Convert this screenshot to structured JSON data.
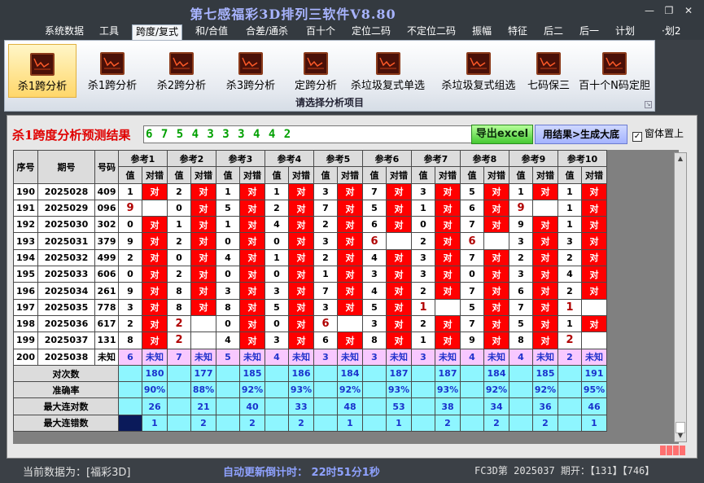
{
  "app": {
    "title": "第七感福彩3D排列三软件V8.80",
    "window_controls": {
      "minimize": "—",
      "restore": "❐",
      "close": "✕"
    }
  },
  "menu": {
    "items": [
      "系统数据",
      "工具",
      "跨度/复式",
      "和/合值",
      "合差/通杀",
      "百十个",
      "定位二码",
      "不定位二码",
      "振幅",
      "特征",
      "后二",
      "后一",
      "计划",
      "·划2"
    ],
    "active_index": 2
  },
  "ribbon": {
    "buttons": [
      "杀1跨分析",
      "杀1跨分析",
      "杀2跨分析",
      "杀3跨分析",
      "定跨分析",
      "杀垃圾复式单选",
      "杀垃圾复式组选",
      "七码保三",
      "百十个N码定胆"
    ],
    "selected_index": 0,
    "caption": "请选择分析项目",
    "icon": "chart-icon"
  },
  "panel": {
    "prediction_title": "杀1跨度分析预测结果",
    "prediction_value": "6 7 5 4 3 3 3 4 4 2",
    "export_button": "导出excel",
    "generate_button": "用结果>生成大底",
    "always_on_top_label": "窗体置上",
    "always_on_top_checked": true,
    "checkmark": "✓"
  },
  "grid": {
    "headers": {
      "seq": "序号",
      "period": "期号",
      "number": "号码",
      "value": "值",
      "correct": "对错"
    },
    "refs": [
      "参考1",
      "参考2",
      "参考3",
      "参考4",
      "参考5",
      "参考6",
      "参考7",
      "参考8",
      "参考9",
      "参考10"
    ],
    "correct_mark": "对",
    "rows": [
      {
        "seq": "190",
        "period": "2025028",
        "number": "409",
        "vals": [
          "1",
          "2",
          "1",
          "1",
          "3",
          "7",
          "3",
          "5",
          "1",
          "1"
        ],
        "ok": [
          1,
          1,
          1,
          1,
          1,
          1,
          1,
          1,
          1,
          1
        ],
        "alt": []
      },
      {
        "seq": "191",
        "period": "2025029",
        "number": "096",
        "vals": [
          "9",
          "0",
          "5",
          "2",
          "7",
          "5",
          "1",
          "6",
          "9",
          "1"
        ],
        "ok": [
          0,
          1,
          1,
          1,
          1,
          1,
          1,
          1,
          0,
          1
        ],
        "alt": [
          0,
          8
        ]
      },
      {
        "seq": "192",
        "period": "2025030",
        "number": "302",
        "vals": [
          "0",
          "1",
          "1",
          "4",
          "2",
          "6",
          "0",
          "7",
          "9",
          "1"
        ],
        "ok": [
          1,
          1,
          1,
          1,
          1,
          1,
          1,
          1,
          1,
          1
        ],
        "alt": []
      },
      {
        "seq": "193",
        "period": "2025031",
        "number": "379",
        "vals": [
          "9",
          "2",
          "0",
          "0",
          "3",
          "6",
          "2",
          "6",
          "3",
          "3"
        ],
        "ok": [
          1,
          1,
          1,
          1,
          1,
          0,
          1,
          0,
          1,
          1
        ],
        "alt": [
          5,
          7
        ]
      },
      {
        "seq": "194",
        "period": "2025032",
        "number": "499",
        "vals": [
          "2",
          "0",
          "4",
          "1",
          "2",
          "4",
          "3",
          "7",
          "2",
          "2"
        ],
        "ok": [
          1,
          1,
          1,
          1,
          1,
          1,
          1,
          1,
          1,
          1
        ],
        "alt": []
      },
      {
        "seq": "195",
        "period": "2025033",
        "number": "606",
        "vals": [
          "0",
          "2",
          "0",
          "0",
          "1",
          "3",
          "3",
          "0",
          "3",
          "4"
        ],
        "ok": [
          1,
          1,
          1,
          1,
          1,
          1,
          1,
          1,
          1,
          1
        ],
        "alt": []
      },
      {
        "seq": "196",
        "period": "2025034",
        "number": "261",
        "vals": [
          "9",
          "8",
          "3",
          "3",
          "7",
          "4",
          "2",
          "7",
          "6",
          "2"
        ],
        "ok": [
          1,
          1,
          1,
          1,
          1,
          1,
          1,
          1,
          1,
          1
        ],
        "alt": []
      },
      {
        "seq": "197",
        "period": "2025035",
        "number": "778",
        "vals": [
          "3",
          "8",
          "8",
          "5",
          "3",
          "5",
          "1",
          "5",
          "7",
          "1"
        ],
        "ok": [
          1,
          1,
          1,
          1,
          1,
          1,
          0,
          1,
          1,
          0
        ],
        "alt": [
          6,
          9
        ]
      },
      {
        "seq": "198",
        "period": "2025036",
        "number": "617",
        "vals": [
          "2",
          "2",
          "0",
          "0",
          "6",
          "3",
          "2",
          "7",
          "5",
          "1"
        ],
        "ok": [
          1,
          0,
          1,
          1,
          0,
          1,
          1,
          1,
          1,
          1
        ],
        "alt": [
          1,
          4
        ]
      },
      {
        "seq": "199",
        "period": "2025037",
        "number": "131",
        "vals": [
          "8",
          "2",
          "4",
          "3",
          "6",
          "8",
          "1",
          "9",
          "8",
          "2"
        ],
        "ok": [
          1,
          0,
          1,
          1,
          1,
          1,
          1,
          1,
          1,
          0
        ],
        "alt": [
          1,
          9
        ]
      }
    ],
    "pred_row": {
      "seq": "200",
      "period": "2025038",
      "number": "未知",
      "vals": [
        "6",
        "7",
        "5",
        "4",
        "3",
        "3",
        "3",
        "4",
        "4",
        "2"
      ],
      "unknown": "未知"
    },
    "stats": [
      {
        "label": "对次数",
        "values": [
          "180",
          "177",
          "185",
          "186",
          "184",
          "187",
          "187",
          "184",
          "185",
          "191"
        ]
      },
      {
        "label": "准确率",
        "values": [
          "90%",
          "88%",
          "92%",
          "93%",
          "92%",
          "93%",
          "93%",
          "92%",
          "92%",
          "95%"
        ]
      },
      {
        "label": "最大连对数",
        "values": [
          "26",
          "21",
          "40",
          "33",
          "48",
          "53",
          "38",
          "34",
          "36",
          "46"
        ]
      },
      {
        "label": "最大连错数",
        "values": [
          "1",
          "2",
          "2",
          "2",
          "1",
          "1",
          "2",
          "2",
          "2",
          "1"
        ]
      }
    ]
  },
  "status": {
    "current_data": "当前数据为：[福彩3D]",
    "countdown": "自动更新倒计时： 22时51分1秒",
    "latest": "FC3D第 2025037 期开：【131】【746】"
  }
}
